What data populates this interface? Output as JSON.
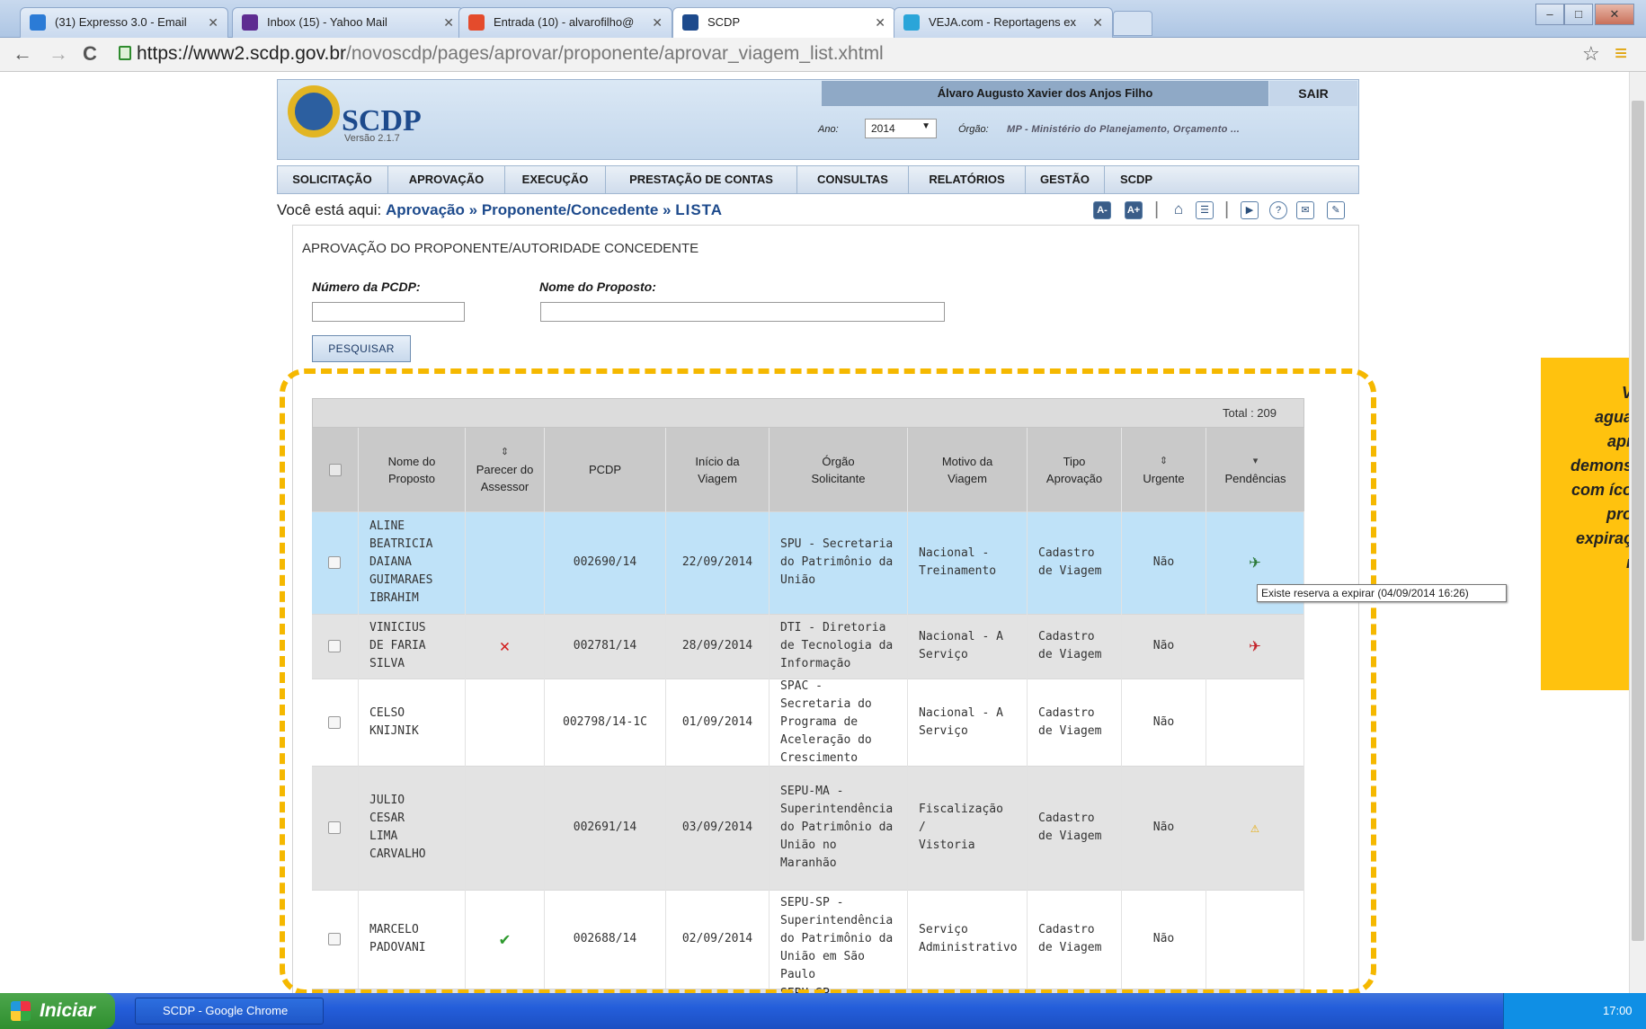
{
  "browser": {
    "tabs": [
      {
        "label": "(31) Expresso 3.0 - Email",
        "color": "#2b7bd6"
      },
      {
        "label": "Inbox (15) - Yahoo Mail",
        "color": "#5e2c91"
      },
      {
        "label": "Entrada (10) - alvarofilho@",
        "color": "#e44b2c"
      },
      {
        "label": "SCDP",
        "color": "#1d4a8c"
      },
      {
        "label": "VEJA.com - Reportagens ex",
        "color": "#2aa5d9"
      }
    ],
    "url_host": "https://www2.scdp.gov.br",
    "url_path": "/novoscdp/pages/aprovar/proponente/aprovar_viagem_list.xhtml"
  },
  "header": {
    "logo": "SCDP",
    "version": "Versão 2.1.7",
    "user": "Álvaro Augusto Xavier dos Anjos Filho",
    "logout": "SAIR",
    "ano_label": "Ano:",
    "ano_value": "2014",
    "orgao_label": "Órgão:",
    "orgao_value": "MP - Ministério do Planejamento, Orçamento ..."
  },
  "menu": [
    "SOLICITAÇÃO",
    "APROVAÇÃO",
    "EXECUÇÃO",
    "PRESTAÇÃO DE CONTAS",
    "CONSULTAS",
    "RELATÓRIOS",
    "GESTÃO",
    "SCDP"
  ],
  "breadcrumb": {
    "prefix": "Você está aqui:",
    "items": [
      "Aprovação",
      "Proponente/Concedente",
      "LISTA"
    ]
  },
  "toolbar_icons": [
    "font-decrease-icon",
    "font-increase-icon",
    "home-icon",
    "chat-icon",
    "video-icon",
    "help-icon",
    "mail-icon",
    "feedback-icon"
  ],
  "form": {
    "title": "APROVAÇÃO DO PROPONENTE/AUTORIDADE CONCEDENTE",
    "numero_label": "Número da PCDP:",
    "numero_value": "",
    "nome_label": "Nome do Proposto:",
    "nome_value": "",
    "search_button": "PESQUISAR"
  },
  "table": {
    "total": "Total : 209",
    "headers": [
      "Nome do Proposto",
      "Parecer do Assessor",
      "PCDP",
      "Início da Viagem",
      "Órgão Solicitante",
      "Motivo da Viagem",
      "Tipo Aprovação",
      "Urgente",
      "Pendências"
    ],
    "rows": [
      {
        "nome": [
          "ALINE",
          "BEATRICIA",
          "DAIANA",
          "GUIMARAES",
          "IBRAHIM"
        ],
        "parecer": "",
        "pcdp": "002690/14",
        "inicio": "22/09/2014",
        "orgao": [
          "SPU - Secretaria",
          "do Patrimônio da",
          "União"
        ],
        "motivo": [
          "Nacional -",
          "Treinamento"
        ],
        "tipo": [
          "Cadastro",
          "de Viagem"
        ],
        "urgente": "Não",
        "pendencia": "plane-green",
        "bg": "#bfe2f8"
      },
      {
        "nome": [
          "VINICIUS",
          "DE FARIA",
          "SILVA"
        ],
        "parecer": "reject",
        "pcdp": "002781/14",
        "inicio": "28/09/2014",
        "orgao": [
          "DTI - Diretoria",
          "de Tecnologia da",
          "Informação"
        ],
        "motivo": [
          "Nacional - A",
          "Serviço"
        ],
        "tipo": [
          "Cadastro",
          "de Viagem"
        ],
        "urgente": "Não",
        "pendencia": "plane-red",
        "bg": "#e3e3e3"
      },
      {
        "nome": [
          "CELSO",
          "KNIJNIK"
        ],
        "parecer": "",
        "pcdp": "002798/14-1C",
        "inicio": "01/09/2014",
        "orgao": [
          "SPAC -",
          "Secretaria do",
          "Programa de",
          "Aceleração do",
          "Crescimento"
        ],
        "motivo": [
          "Nacional - A",
          "Serviço"
        ],
        "tipo": [
          "Cadastro",
          "de Viagem"
        ],
        "urgente": "Não",
        "pendencia": "",
        "bg": "#ffffff"
      },
      {
        "nome": [
          "JULIO",
          "CESAR",
          "LIMA",
          "CARVALHO"
        ],
        "parecer": "",
        "pcdp": "002691/14",
        "inicio": "03/09/2014",
        "orgao": [
          "SEPU-MA -",
          "Superintendência",
          "do Patrimônio da",
          "União no",
          "Maranhão"
        ],
        "motivo": [
          "Fiscalização /",
          "Vistoria"
        ],
        "tipo": [
          "Cadastro",
          "de Viagem"
        ],
        "urgente": "Não",
        "pendencia": "warning",
        "bg": "#e3e3e3"
      },
      {
        "nome": [
          "MARCELO",
          "PADOVANI"
        ],
        "parecer": "approve",
        "pcdp": "002688/14",
        "inicio": "02/09/2014",
        "orgao": [
          "SEPU-SP -",
          "Superintendência",
          "do Patrimônio da",
          "União em São",
          "Paulo"
        ],
        "motivo": [
          "Serviço",
          "Administrativo"
        ],
        "tipo": [
          "Cadastro",
          "de Viagem"
        ],
        "urgente": "Não",
        "pendencia": "",
        "bg": "#ffffff"
      }
    ],
    "partial_row": "SEPU-SP -"
  },
  "tooltip": "Existe reserva a expirar (04/09/2014 16:26)",
  "note_lines": [
    "V",
    "agua",
    "apr",
    "demons",
    "com íco",
    "pro",
    "expiraç",
    "r"
  ],
  "taskbar": {
    "start": "Iniciar",
    "item": "SCDP - Google Chrome",
    "clock": "17:00"
  },
  "colors": {
    "highlight_dash": "#f5b800",
    "note_bg": "#ffc20e",
    "brand_blue": "#1d4a8c"
  }
}
